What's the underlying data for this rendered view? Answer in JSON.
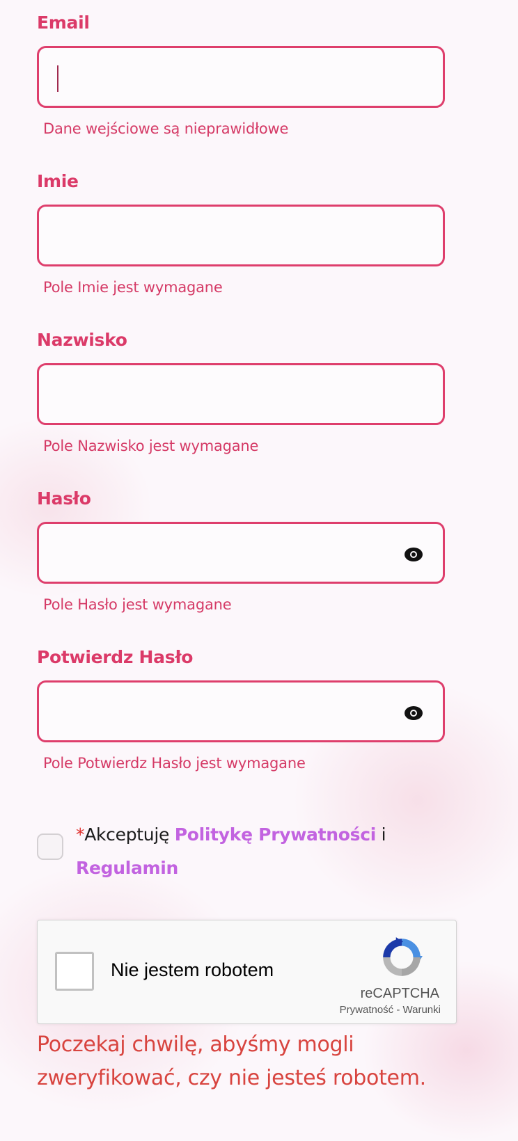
{
  "form": {
    "fields": [
      {
        "label": "Email",
        "value": "",
        "error": "Dane wejściowe są nieprawidłowe",
        "toggle_icon": null
      },
      {
        "label": "Imie",
        "value": "",
        "error": "Pole Imie jest wymagane",
        "toggle_icon": null
      },
      {
        "label": "Nazwisko",
        "value": "",
        "error": "Pole Nazwisko jest wymagane",
        "toggle_icon": null
      },
      {
        "label": "Hasło",
        "value": "",
        "error": "Pole Hasło jest wymagane",
        "toggle_icon": "eye-icon"
      },
      {
        "label": "Potwierdz Hasło",
        "value": "",
        "error": "Pole Potwierdz Hasło jest wymagane",
        "toggle_icon": "eye-icon"
      }
    ],
    "consent": {
      "required_mark": "*",
      "text_before": "Akceptuję ",
      "privacy_link": "Politykę Prywatności",
      "conjunction": " i ",
      "terms_link": "Regulamin",
      "checked": false
    },
    "recaptcha": {
      "label": "Nie jestem robotem",
      "brand": "reCAPTCHA",
      "privacy": "Prywatność",
      "separator": " - ",
      "terms": "Warunki",
      "checked": false
    },
    "wait_message": "Poczekaj chwilę, abyśmy mogli zweryfikować, czy nie jesteś robotem."
  },
  "colors": {
    "label": "#db3a68",
    "field_border": "#de3e6c",
    "error": "#d53a66",
    "link": "#c263e0",
    "wait_message": "#d8443f"
  }
}
